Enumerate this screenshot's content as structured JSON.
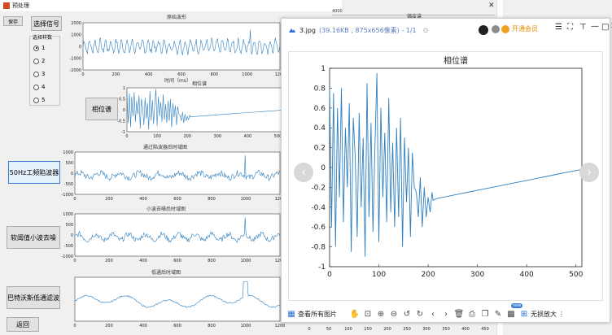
{
  "main_window": {
    "title": "预处理",
    "save_label": "保存",
    "select_signal_label": "选择信号",
    "group_label": "选择样数",
    "radios": [
      "1",
      "2",
      "3",
      "4",
      "5"
    ],
    "phase_button": "相位谱",
    "notch_button": "50Hz工频陷波器",
    "wavelet_button": "软阈值小波去噪",
    "butter_button": "巴特沃斯低通滤波",
    "back_button": "返回"
  },
  "plots": {
    "p1": {
      "title": "原始波形",
      "xlabel": "时间（ms）",
      "xticks": [
        "0",
        "200",
        "400",
        "600",
        "800",
        "1000",
        "1200"
      ],
      "yticks": [
        "2000",
        "1000",
        "0",
        "-1000",
        "-2000"
      ]
    },
    "p2": {
      "title": "相位谱",
      "xticks": [
        "0",
        "100",
        "200",
        "300",
        "400",
        "500"
      ],
      "yticks": [
        "1",
        "0.5",
        "0",
        "-0.5",
        "-1"
      ]
    },
    "p3": {
      "title": "通过陷波器后时域图",
      "xticks": [
        "0",
        "200",
        "400",
        "600",
        "800",
        "1000",
        "1200"
      ],
      "yticks": [
        "1000",
        "500",
        "0",
        "-500",
        "-1000"
      ]
    },
    "p4": {
      "title": "小波去噪后时域图",
      "xticks": [
        "0",
        "200",
        "400",
        "600",
        "800",
        "1000",
        "1200"
      ],
      "yticks": [
        "1000",
        "500",
        "0",
        "-500",
        "-1000"
      ]
    },
    "p5": {
      "title": "低通后时域图",
      "xticks": [
        "0",
        "200",
        "400",
        "600",
        "800",
        "1000",
        "1200"
      ]
    },
    "bg_right_title": "幅度谱",
    "bg_bottom_xticks": [
      "0",
      "50",
      "100",
      "150",
      "200",
      "250",
      "300",
      "350",
      "400",
      "450",
      "500"
    ],
    "bg_top_tick": "4000"
  },
  "viewer": {
    "filename": "3.jpg",
    "info": "(39.16KB , 875x656像素) - 1/1",
    "vip_label": "开通会员",
    "view_all": "查看所有图片",
    "zoom_label": "无损放大",
    "new_badge": "new",
    "chart_title": "相位谱"
  },
  "chart_data": {
    "type": "line",
    "title": "相位谱",
    "xlabel": "",
    "ylabel": "",
    "xlim": [
      0,
      512
    ],
    "ylim": [
      -1,
      1
    ],
    "xticks": [
      0,
      100,
      200,
      300,
      400,
      500
    ],
    "yticks": [
      -1,
      -0.8,
      -0.6,
      -0.4,
      -0.2,
      0,
      0.2,
      0.4,
      0.6,
      0.8,
      1
    ],
    "series": [
      {
        "color": "#2f7fbf",
        "x": [
          0,
          4,
          8,
          12,
          16,
          20,
          24,
          28,
          32,
          36,
          40,
          44,
          48,
          52,
          56,
          60,
          64,
          68,
          72,
          76,
          80,
          84,
          88,
          92,
          96,
          100,
          104,
          108,
          112,
          116,
          120,
          124,
          128,
          132,
          136,
          140,
          144,
          148,
          152,
          156,
          160,
          164,
          168,
          172,
          176,
          180,
          184,
          188,
          192,
          196,
          200,
          204,
          208,
          210,
          214,
          220,
          240,
          260,
          280,
          300,
          320,
          340,
          360,
          380,
          400,
          420,
          440,
          460,
          480,
          500,
          512
        ],
        "y": [
          0.8,
          -0.6,
          0.75,
          -0.8,
          0.6,
          -0.3,
          0.8,
          -0.55,
          0.4,
          -0.2,
          0.65,
          -0.85,
          0.5,
          0.1,
          -0.7,
          0.55,
          -0.4,
          0.3,
          -0.9,
          0.85,
          -0.5,
          0.45,
          -0.65,
          0.2,
          0.95,
          -0.75,
          0.6,
          -0.3,
          0.35,
          -0.55,
          0.7,
          -0.45,
          0.25,
          -0.6,
          0.4,
          -0.5,
          0.5,
          -0.8,
          0.3,
          -0.35,
          0.2,
          -0.7,
          0.15,
          -0.2,
          -0.25,
          -0.5,
          -0.1,
          -0.6,
          -0.2,
          -0.5,
          -0.3,
          -0.45,
          -0.25,
          -0.33,
          -0.32,
          -0.31,
          -0.29,
          -0.27,
          -0.25,
          -0.23,
          -0.21,
          -0.19,
          -0.17,
          -0.15,
          -0.13,
          -0.11,
          -0.09,
          -0.07,
          -0.05,
          -0.03,
          -0.02
        ]
      }
    ]
  }
}
